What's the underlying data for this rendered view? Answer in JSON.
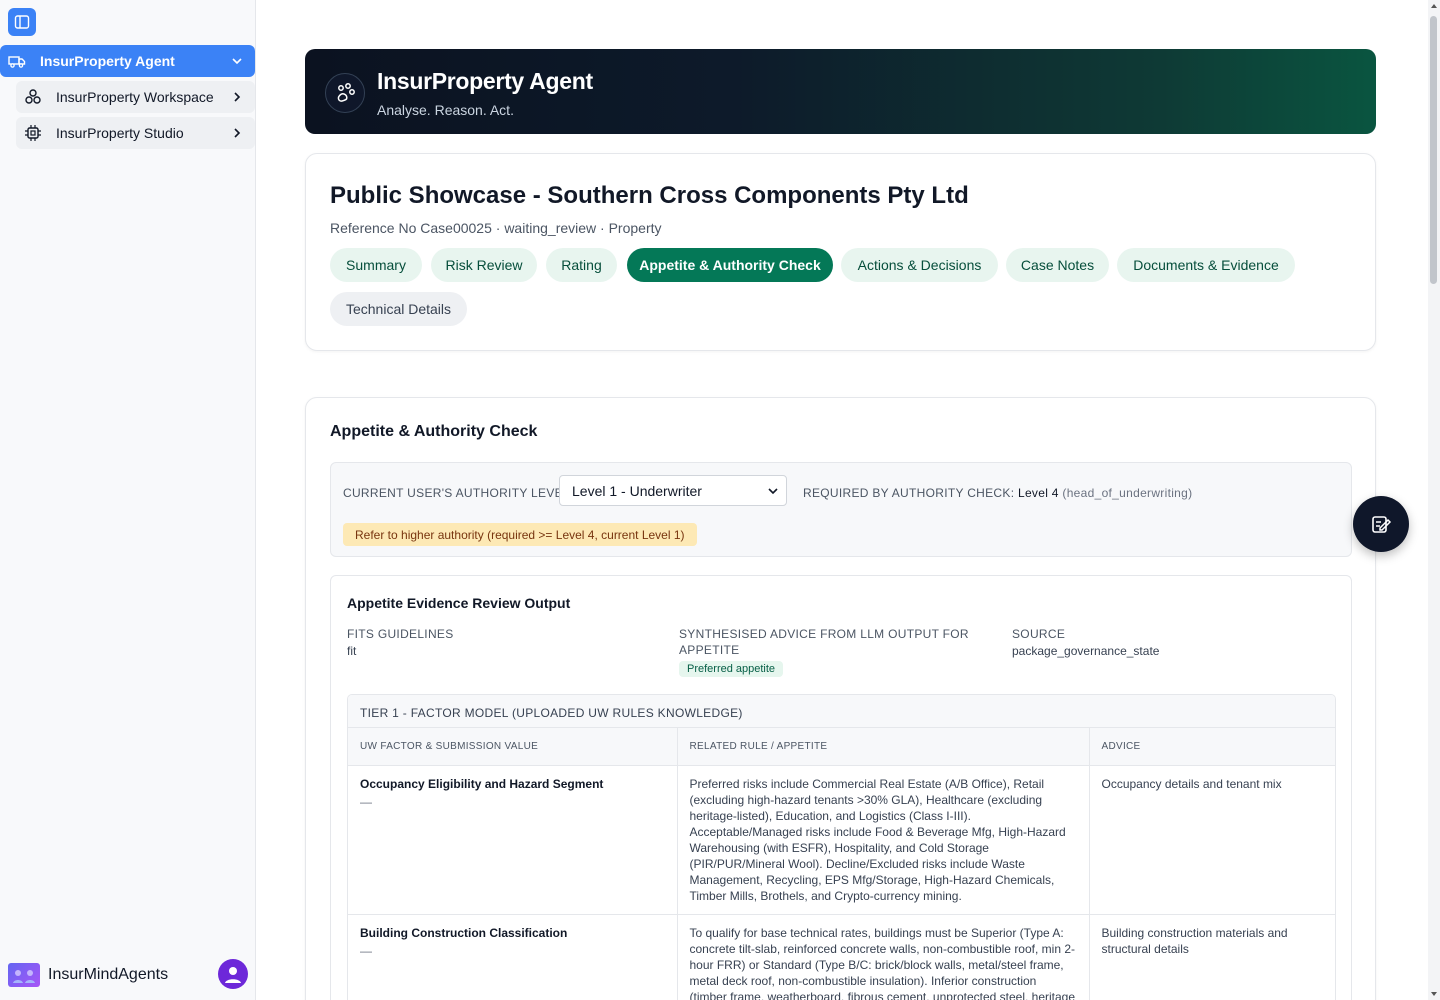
{
  "sidebar": {
    "toggle_icon": "sidebar-toggle-icon",
    "active_item": {
      "label": "InsurProperty Agent",
      "icon": "truck-icon"
    },
    "sub_items": [
      {
        "label": "InsurProperty Workspace",
        "icon": "workspace-cluster-icon"
      },
      {
        "label": "InsurProperty Studio",
        "icon": "chip-icon"
      }
    ],
    "footer": {
      "brand": "InsurMindAgents",
      "logo_icon": "brand-logo-icon",
      "avatar_icon": "user-avatar-icon"
    }
  },
  "hero": {
    "title": "InsurProperty Agent",
    "subtitle": "Analyse. Reason. Act."
  },
  "case": {
    "title": "Public Showcase - Southern Cross Components Pty Ltd",
    "meta": "Reference No Case00025 · waiting_review · Property",
    "tabs": [
      {
        "label": "Summary"
      },
      {
        "label": "Risk Review"
      },
      {
        "label": "Rating"
      },
      {
        "label": "Appetite & Authority Check"
      },
      {
        "label": "Actions & Decisions"
      },
      {
        "label": "Case Notes"
      },
      {
        "label": "Documents & Evidence"
      },
      {
        "label": "Technical Details"
      }
    ],
    "active_tab": "Appetite & Authority Check"
  },
  "section": {
    "title": "Appetite & Authority Check",
    "authority": {
      "label": "CURRENT USER'S AUTHORITY LEVEL",
      "selected": "Level 1 - Underwriter",
      "required_label": "REQUIRED BY AUTHORITY CHECK:",
      "required_value": "Level 4",
      "required_role": "(head_of_underwriting)",
      "warning": "Refer to higher authority (required >= Level 4, current Level 1)"
    },
    "evidence": {
      "title": "Appetite Evidence Review Output",
      "fits_label": "FITS GUIDELINES",
      "fits_value": "fit",
      "advice_label": "SYNTHESISED ADVICE FROM LLM OUTPUT FOR APPETITE",
      "advice_value": "Preferred appetite",
      "source_label": "SOURCE",
      "source_value": "package_governance_state",
      "tier_title": "TIER 1 - FACTOR MODEL (UPLOADED UW RULES KNOWLEDGE)",
      "columns": [
        "UW FACTOR & SUBMISSION VALUE",
        "RELATED RULE / APPETITE",
        "ADVICE"
      ],
      "rows": [
        {
          "factor": "Occupancy Eligibility and Hazard Segment",
          "value": "—",
          "rule": "Preferred risks include Commercial Real Estate (A/B Office), Retail (excluding high-hazard tenants >30% GLA), Healthcare (excluding heritage-listed), Education, and Logistics (Class I-III). Acceptable/Managed risks include Food & Beverage Mfg, High-Hazard Warehousing (with ESFR), Hospitality, and Cold Storage (PIR/PUR/Mineral Wool). Decline/Excluded risks include Waste Management, Recycling, EPS Mfg/Storage, High-Hazard Chemicals, Timber Mills, Brothels, and Crypto-currency mining.",
          "advice": "Occupancy details and tenant mix"
        },
        {
          "factor": "Building Construction Classification",
          "value": "—",
          "rule": "To qualify for base technical rates, buildings must be Superior (Type A: concrete tilt-slab, reinforced concrete walls, non-combustible roof, min 2-hour FRR) or Standard (Type B/C: brick/block walls, metal/steel frame, metal deck roof, non-combustible insulation). Inferior construction (timber frame, weatherboard, fibrous cement, unprotected steel, heritage",
          "advice": "Building construction materials and structural details"
        }
      ]
    }
  },
  "fab_icon": "edit-note-icon",
  "colors": {
    "accent_blue": "#3b82f6",
    "accent_green": "#047857",
    "warning_bg": "#fde9b5"
  }
}
